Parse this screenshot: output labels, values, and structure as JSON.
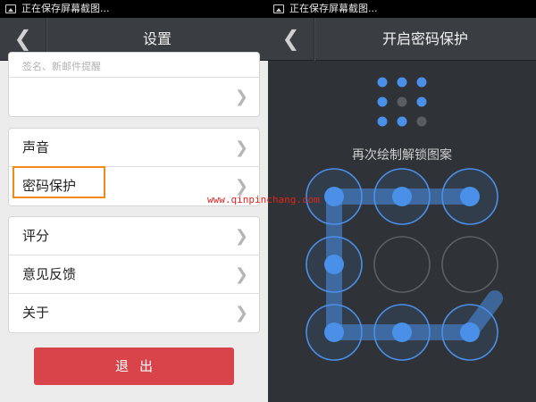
{
  "left": {
    "status_text": "正在保存屏幕截图...",
    "back_glyph": "❮",
    "title": "设置",
    "top_hint": "签名、新邮件提醒",
    "chevron": "❯",
    "groups": [
      {
        "items": [
          {
            "label": "声音"
          },
          {
            "label": "密码保护"
          }
        ]
      },
      {
        "items": [
          {
            "label": "评分"
          },
          {
            "label": "意见反馈"
          },
          {
            "label": "关于"
          }
        ]
      }
    ],
    "logout_label": "退出",
    "highlight_color": "#f08a1c",
    "logout_color": "#d9434a"
  },
  "watermark": "www.qinpinchang.com",
  "right": {
    "status_text": "正在保存屏幕截图...",
    "back_glyph": "❮",
    "title": "开启密码保护",
    "prompt": "再次绘制解锁图案",
    "accent_color": "#4a90e8",
    "preview_dots_active": [
      true,
      true,
      true,
      true,
      false,
      true,
      true,
      true,
      false
    ],
    "pattern_nodes_active": [
      true,
      true,
      true,
      true,
      false,
      false,
      true,
      true,
      true
    ],
    "pattern_path": [
      2,
      1,
      0,
      3,
      6,
      7,
      8
    ]
  }
}
